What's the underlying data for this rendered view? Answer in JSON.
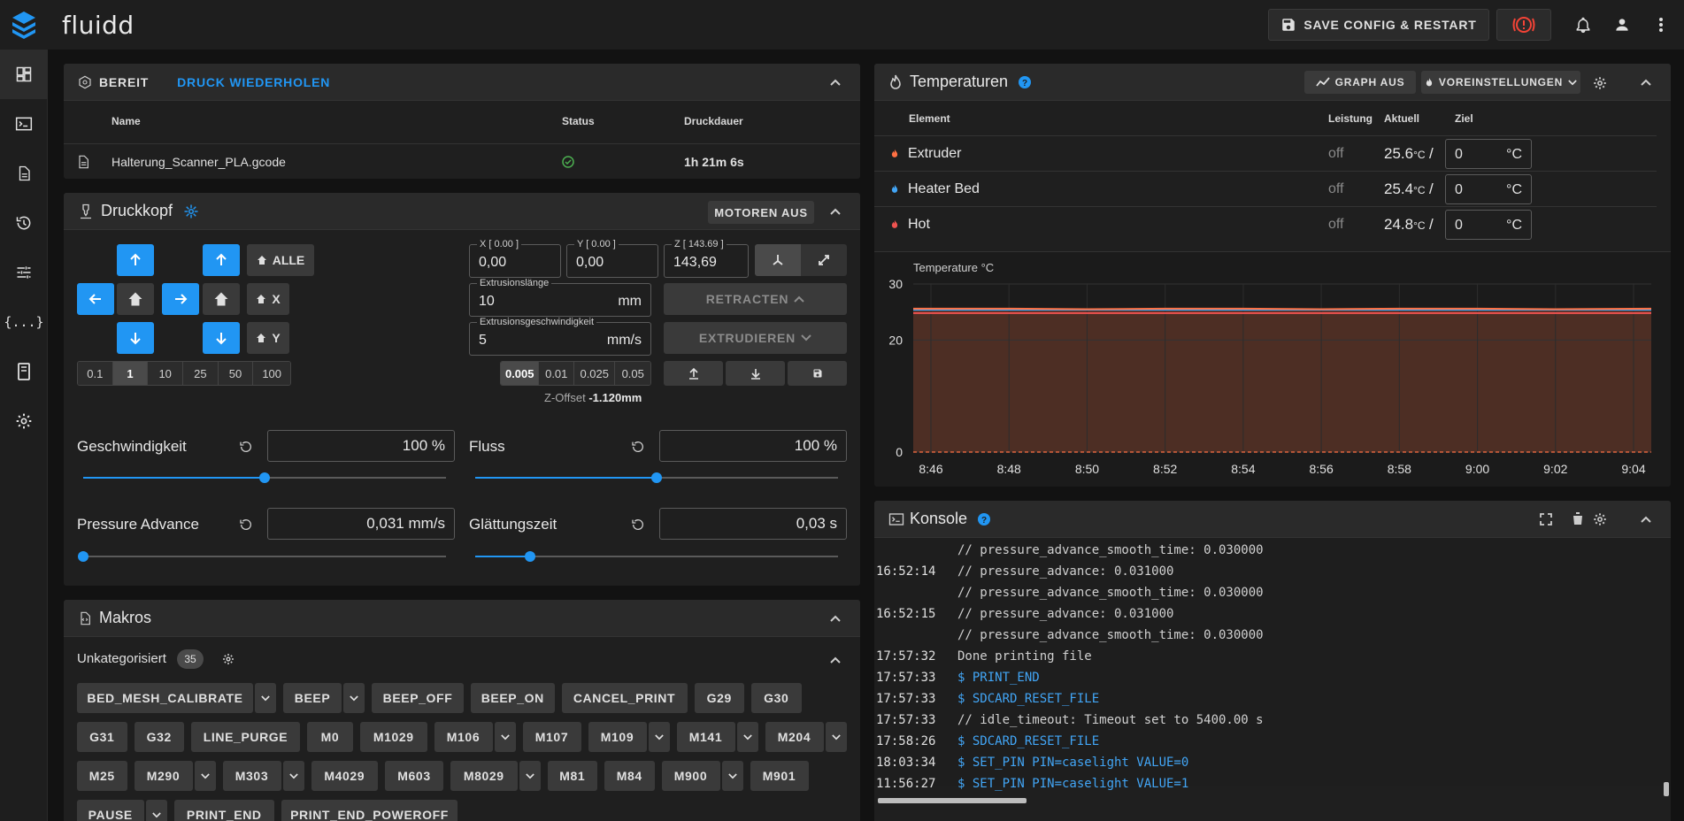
{
  "app": {
    "brand": "fluidd",
    "save_label": "SAVE CONFIG & RESTART"
  },
  "colors": {
    "accent": "#2196f3",
    "extruder": "#ff7043",
    "bed": "#42a5f5",
    "hot": "#ef5350",
    "emergency": "#f44336"
  },
  "status": {
    "state_label": "BEREIT",
    "reprint_label": "DRUCK WIEDERHOLEN",
    "columns": {
      "name": "Name",
      "status": "Status",
      "duration": "Druckdauer"
    },
    "job": {
      "file": "Halterung_Scanner_PLA.gcode",
      "duration": "1h 21m 6s"
    }
  },
  "toolhead": {
    "title": "Druckkopf",
    "motors_off": "MOTOREN AUS",
    "home_all": "ALLE",
    "home_x": "X",
    "home_y": "Y",
    "steps": [
      "0.1",
      "1",
      "10",
      "25",
      "50",
      "100"
    ],
    "step_selected": "1",
    "x": {
      "label": "X [ 0.00 ]",
      "value": "0,00"
    },
    "y": {
      "label": "Y [ 0.00 ]",
      "value": "0,00"
    },
    "z": {
      "label": "Z [ 143.69 ]",
      "value": "143,69"
    },
    "extrude_len": {
      "label": "Extrusionslänge",
      "value": "10",
      "unit": "mm"
    },
    "extrude_speed": {
      "label": "Extrusionsgeschwindigkeit",
      "value": "5",
      "unit": "mm/s"
    },
    "retract_label": "RETRACTEN",
    "extrude_label": "EXTRUDIEREN",
    "zsteps": [
      "0.005",
      "0.01",
      "0.025",
      "0.05"
    ],
    "zstep_selected": "0.005",
    "zoffset_label": "Z-Offset",
    "zoffset_value": "-1.120mm",
    "speed": {
      "label": "Geschwindigkeit",
      "value": "100 %",
      "fraction": 0.5
    },
    "flow": {
      "label": "Fluss",
      "value": "100 %",
      "fraction": 0.5
    },
    "pa": {
      "label": "Pressure Advance",
      "value": "0,031 mm/s",
      "fraction": 0.0
    },
    "smooth": {
      "label": "Glättungszeit",
      "value": "0,03 s",
      "fraction": 0.15
    }
  },
  "macros": {
    "title": "Makros",
    "category": "Unkategorisiert",
    "count": "35",
    "items": [
      {
        "label": "BED_MESH_CALIBRATE",
        "dd": true
      },
      {
        "label": "BEEP",
        "dd": true
      },
      {
        "label": "BEEP_OFF",
        "dd": false
      },
      {
        "label": "BEEP_ON",
        "dd": false
      },
      {
        "label": "CANCEL_PRINT",
        "dd": false
      },
      {
        "label": "G29",
        "dd": false
      },
      {
        "label": "G30",
        "dd": false
      },
      {
        "label": "G31",
        "dd": false
      },
      {
        "label": "G32",
        "dd": false
      },
      {
        "label": "LINE_PURGE",
        "dd": false
      },
      {
        "label": "M0",
        "dd": false
      },
      {
        "label": "M1029",
        "dd": false
      },
      {
        "label": "M106",
        "dd": true
      },
      {
        "label": "M107",
        "dd": false
      },
      {
        "label": "M109",
        "dd": true
      },
      {
        "label": "M141",
        "dd": true
      },
      {
        "label": "M204",
        "dd": true
      },
      {
        "label": "M25",
        "dd": false
      },
      {
        "label": "M290",
        "dd": true
      },
      {
        "label": "M303",
        "dd": true
      },
      {
        "label": "M4029",
        "dd": false
      },
      {
        "label": "M603",
        "dd": false
      },
      {
        "label": "M8029",
        "dd": true
      },
      {
        "label": "M81",
        "dd": false
      },
      {
        "label": "M84",
        "dd": false
      },
      {
        "label": "M900",
        "dd": true
      },
      {
        "label": "M901",
        "dd": false
      },
      {
        "label": "PAUSE",
        "dd": true
      },
      {
        "label": "PRINT_END",
        "dd": false
      },
      {
        "label": "PRINT_END_POWEROFF",
        "dd": false
      }
    ]
  },
  "temps": {
    "title": "Temperaturen",
    "graph_label": "GRAPH AUS",
    "presets_label": "VOREINSTELLUNGEN",
    "columns": {
      "element": "Element",
      "power": "Leistung",
      "current": "Aktuell",
      "target": "Ziel"
    },
    "rows": [
      {
        "name": "Extruder",
        "power": "off",
        "current": "25.6",
        "unit": "°C",
        "target": "0",
        "target_unit": "°C"
      },
      {
        "name": "Heater Bed",
        "power": "off",
        "current": "25.4",
        "unit": "°C",
        "target": "0",
        "target_unit": "°C"
      },
      {
        "name": "Hot",
        "power": "off",
        "current": "24.8",
        "unit": "°C",
        "target": "0",
        "target_unit": "°C"
      }
    ]
  },
  "chart_data": {
    "type": "line",
    "title": "",
    "ylabel": "Temperature °C",
    "xlabel": "",
    "x": [
      "8:46",
      "8:48",
      "8:50",
      "8:52",
      "8:54",
      "8:56",
      "8:58",
      "9:00",
      "9:02",
      "9:04"
    ],
    "y_ticks": [
      0,
      20,
      30
    ],
    "ylim": [
      0,
      30
    ],
    "series": [
      {
        "name": "Extruder",
        "values": [
          25.6,
          25.6,
          25.5,
          25.6,
          25.6,
          25.5,
          25.6,
          25.6,
          25.5,
          25.6
        ]
      },
      {
        "name": "Heater Bed",
        "values": [
          25.4,
          25.4,
          25.4,
          25.4,
          25.4,
          25.4,
          25.4,
          25.4,
          25.4,
          25.4
        ]
      },
      {
        "name": "Hot",
        "values": [
          24.8,
          24.8,
          24.8,
          24.8,
          24.8,
          24.8,
          24.8,
          24.8,
          24.8,
          24.8
        ]
      }
    ],
    "grid": true
  },
  "console": {
    "title": "Konsole",
    "lines": [
      {
        "ts": "",
        "text": "// pressure_advance_smooth_time: 0.030000",
        "cmd": false
      },
      {
        "ts": "16:52:14",
        "text": "// pressure_advance: 0.031000",
        "cmd": false
      },
      {
        "ts": "",
        "text": "// pressure_advance_smooth_time: 0.030000",
        "cmd": false
      },
      {
        "ts": "16:52:15",
        "text": "// pressure_advance: 0.031000",
        "cmd": false
      },
      {
        "ts": "",
        "text": "// pressure_advance_smooth_time: 0.030000",
        "cmd": false
      },
      {
        "ts": "17:57:32",
        "text": "Done printing file",
        "cmd": false
      },
      {
        "ts": "17:57:33",
        "text": "$ PRINT_END",
        "cmd": true
      },
      {
        "ts": "17:57:33",
        "text": "$ SDCARD_RESET_FILE",
        "cmd": true
      },
      {
        "ts": "17:57:33",
        "text": "// idle_timeout: Timeout set to 5400.00 s",
        "cmd": false
      },
      {
        "ts": "17:58:26",
        "text": "$ SDCARD_RESET_FILE",
        "cmd": true
      },
      {
        "ts": "18:03:34",
        "text": "$ SET_PIN PIN=caselight VALUE=0",
        "cmd": true
      },
      {
        "ts": "11:56:27",
        "text": "$ SET_PIN PIN=caselight VALUE=1",
        "cmd": true
      }
    ]
  }
}
